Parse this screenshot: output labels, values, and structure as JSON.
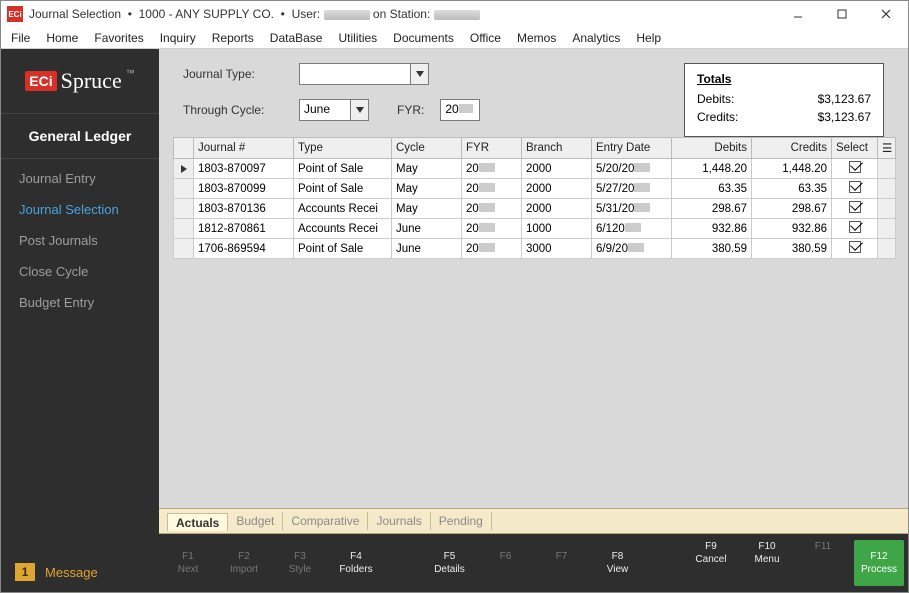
{
  "titlebar": {
    "logo_text": "ECi",
    "title_prefix": "Journal Selection",
    "company": "1000 - ANY SUPPLY CO.",
    "user_label": "User:",
    "station_label": "on Station:"
  },
  "menu": [
    "File",
    "Home",
    "Favorites",
    "Inquiry",
    "Reports",
    "DataBase",
    "Utilities",
    "Documents",
    "Office",
    "Memos",
    "Analytics",
    "Help"
  ],
  "brand": {
    "eci": "ECi",
    "name": "Spruce",
    "tm": "™"
  },
  "sidebar": {
    "heading": "General Ledger",
    "items": [
      {
        "label": "Journal Entry",
        "active": false
      },
      {
        "label": "Journal Selection",
        "active": true
      },
      {
        "label": "Post Journals",
        "active": false
      },
      {
        "label": "Close Cycle",
        "active": false
      },
      {
        "label": "Budget Entry",
        "active": false
      }
    ],
    "message_count": "1",
    "message_label": "Message"
  },
  "filters": {
    "type_label": "Journal Type:",
    "type_value": "",
    "through_label": "Through Cycle:",
    "through_value": "June",
    "fyr_label": "FYR:",
    "fyr_prefix": "20"
  },
  "totals": {
    "heading": "Totals",
    "debits_label": "Debits:",
    "debits_value": "$3,123.67",
    "credits_label": "Credits:",
    "credits_value": "$3,123.67"
  },
  "grid": {
    "columns": [
      "Journal #",
      "Type",
      "Cycle",
      "FYR",
      "Branch",
      "Entry Date",
      "Debits",
      "Credits",
      "Select"
    ],
    "rows": [
      {
        "journal": "1803-870097",
        "type": "Point of Sale",
        "cycle": "May",
        "fyr": "20",
        "branch": "2000",
        "entry": "5/20/20",
        "debits": "1,448.20",
        "credits": "1,448.20"
      },
      {
        "journal": "1803-870099",
        "type": "Point of Sale",
        "cycle": "May",
        "fyr": "20",
        "branch": "2000",
        "entry": "5/27/20",
        "debits": "63.35",
        "credits": "63.35"
      },
      {
        "journal": "1803-870136",
        "type": "Accounts Recei",
        "cycle": "May",
        "fyr": "20",
        "branch": "2000",
        "entry": "5/31/20",
        "debits": "298.67",
        "credits": "298.67"
      },
      {
        "journal": "1812-870861",
        "type": "Accounts Recei",
        "cycle": "June",
        "fyr": "20",
        "branch": "1000",
        "entry": "6/120",
        "debits": "932.86",
        "credits": "932.86"
      },
      {
        "journal": "1706-869594",
        "type": "Point of Sale",
        "cycle": "June",
        "fyr": "20",
        "branch": "3000",
        "entry": "6/9/20",
        "debits": "380.59",
        "credits": "380.59"
      }
    ]
  },
  "tabs": [
    "Actuals",
    "Budget",
    "Comparative",
    "Journals",
    "Pending"
  ],
  "fkeys": [
    {
      "key": "F1",
      "label": "Next",
      "enabled": false
    },
    {
      "key": "F2",
      "label": "Import",
      "enabled": false
    },
    {
      "key": "F3",
      "label": "Style",
      "enabled": false
    },
    {
      "key": "F4",
      "label": "Folders",
      "enabled": true
    },
    {
      "key": "F5",
      "label": "Details",
      "enabled": true
    },
    {
      "key": "F6",
      "label": "",
      "enabled": false
    },
    {
      "key": "F7",
      "label": "",
      "enabled": false
    },
    {
      "key": "F8",
      "label": "View",
      "enabled": true
    },
    {
      "key": "F9",
      "label": "Cancel",
      "enabled": true
    },
    {
      "key": "F10",
      "label": "Menu",
      "enabled": true
    },
    {
      "key": "F11",
      "label": "",
      "enabled": false
    },
    {
      "key": "F12",
      "label": "Process",
      "enabled": true,
      "process": true
    }
  ]
}
